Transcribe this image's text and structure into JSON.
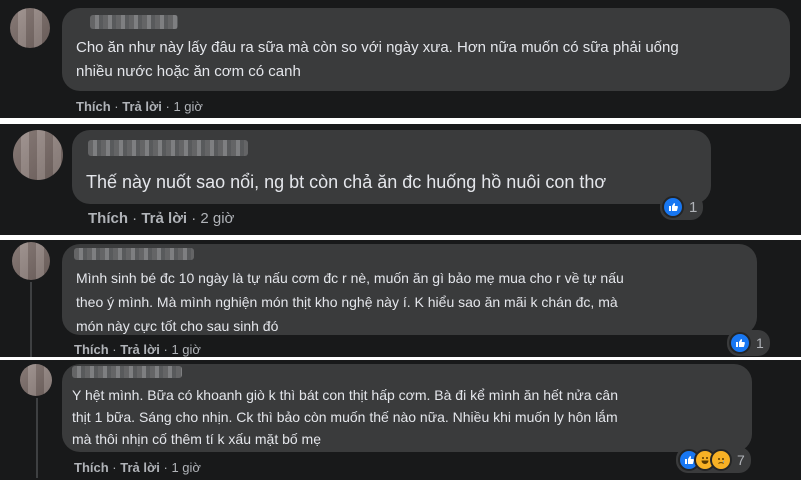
{
  "comments": [
    {
      "text": "Cho ăn như này lấy đâu ra sữa mà còn so với ngày xưa. Hơn nữa muốn có sữa phải uống\nnhiều nước hoặc ăn cơm có canh",
      "like": "Thích",
      "reply": "Trả lời",
      "time": "1 giờ",
      "sep": "·"
    },
    {
      "text": "Thế này nuốt sao nổi, ng bt còn chả ăn đc huống hồ nuôi con thơ",
      "like": "Thích",
      "reply": "Trả lời",
      "time": "2 giờ",
      "sep": "·",
      "reactions": {
        "icons": [
          "like-icon"
        ],
        "count": "1"
      }
    },
    {
      "text": "Mình sinh bé đc 10 ngày là tự nấu cơm đc r nè, muốn ăn gì bảo mẹ mua cho r về tự nấu\ntheo ý mình. Mà mình nghiện món thịt kho nghệ này í. K hiểu sao ăn mãi k chán đc, mà\nmón này cực tốt cho sau sinh đó",
      "like": "Thích",
      "reply": "Trả lời",
      "time": "1 giờ",
      "sep": "·",
      "reactions": {
        "icons": [
          "like-icon"
        ],
        "count": "1"
      }
    },
    {
      "text": "Y hệt mình. Bữa có khoanh giò k thì bát con thịt hấp cơm. Bà đi kể mình ăn hết nửa cân\nthịt 1 bữa. Sáng cho nhịn. Ck thì bảo còn muốn thế nào nữa. Nhiều khi muốn ly hôn lắm\nmà thôi nhịn cố thêm tí k xấu mặt bố mẹ",
      "like": "Thích",
      "reply": "Trả lời",
      "time": "1 giờ",
      "sep": "·",
      "reactions": {
        "icons": [
          "like-icon",
          "haha-icon",
          "sad-icon"
        ],
        "count": "7"
      }
    }
  ],
  "colors": {
    "background": "#18191a",
    "bubble": "#3a3b3c",
    "text": "#e4e6eb",
    "muted": "#b0b3b8",
    "like_blue": "#1877f2"
  }
}
